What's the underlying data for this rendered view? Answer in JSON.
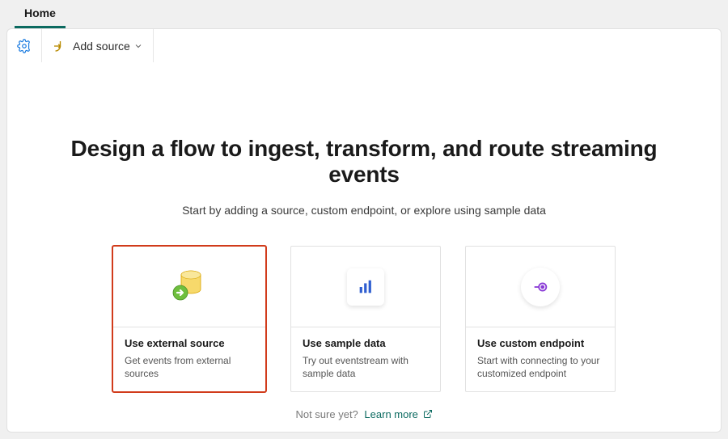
{
  "tabs": {
    "home": "Home"
  },
  "toolbar": {
    "add_source_label": "Add source"
  },
  "hero": {
    "title": "Design a flow to ingest, transform, and route streaming events",
    "subtitle": "Start by adding a source, custom endpoint, or explore using sample data"
  },
  "cards": {
    "external": {
      "title": "Use external source",
      "desc": "Get events from external sources"
    },
    "sample": {
      "title": "Use sample data",
      "desc": "Try out eventstream with sample data"
    },
    "custom": {
      "title": "Use custom endpoint",
      "desc": "Start with connecting to your customized endpoint"
    }
  },
  "footer": {
    "not_sure": "Not sure yet?",
    "learn_more": "Learn more"
  }
}
